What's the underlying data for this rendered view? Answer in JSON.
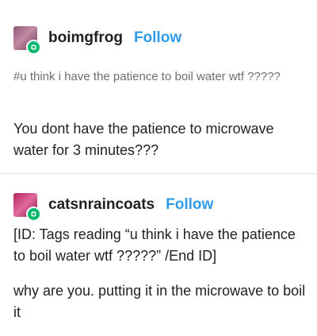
{
  "posts": [
    {
      "username": "boimgfrog",
      "follow_label": "Follow",
      "tags": "#u think i have the patience to boil water wtf ?????",
      "body": "You dont have the patience to microwave water for 3 minutes???"
    },
    {
      "username": "catsnraincoats",
      "follow_label": "Follow",
      "id_text": "[ID: Tags reading “u think i have the patience to boil water wtf ?????” /End ID]",
      "reply": "why are you. putting it in the microwave to boil it"
    }
  ],
  "colors": {
    "follow": "#2f9be8",
    "badge": "#00b86b",
    "tags": "#6e6e6e"
  },
  "icons": [
    "avatar",
    "verified-badge-icon"
  ]
}
